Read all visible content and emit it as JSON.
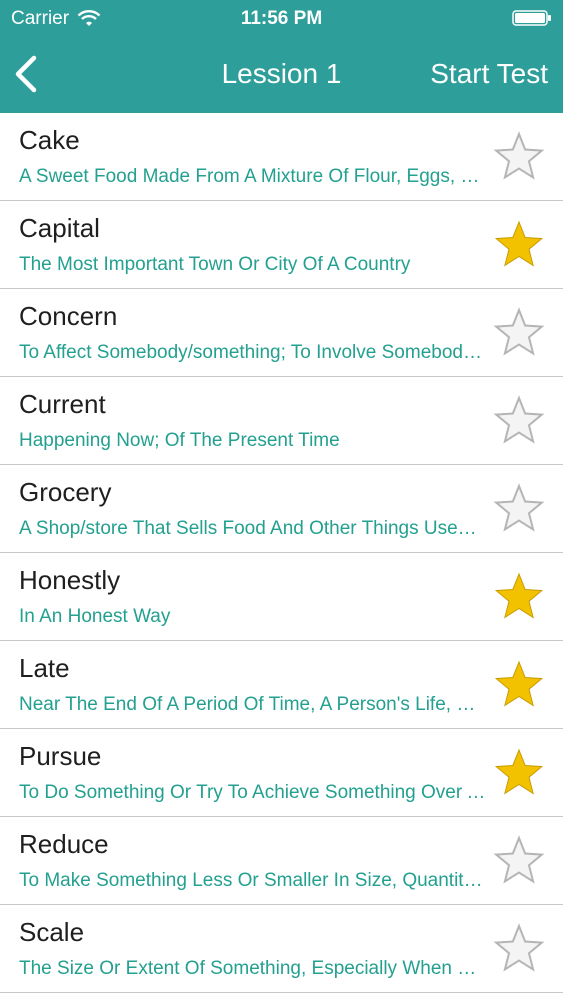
{
  "status": {
    "carrier": "Carrier",
    "time": "11:56 PM"
  },
  "nav": {
    "title": "Lession 1",
    "right_button": "Start Test",
    "back_icon": "chevron-left-icon"
  },
  "colors": {
    "header": "#2d9e9a",
    "definition_text": "#23a08f",
    "star_filled": "#f2c200"
  },
  "words": [
    {
      "word": "Cake",
      "definition": "A Sweet Food Made From A Mixture Of Flour, Eggs, Fat And Sugar",
      "starred": false
    },
    {
      "word": "Capital",
      "definition": "The Most Important Town Or City Of A Country",
      "starred": true
    },
    {
      "word": "Concern",
      "definition": "To Affect Somebody/something; To Involve Somebody/something",
      "starred": false
    },
    {
      "word": "Current",
      "definition": "Happening Now; Of The Present Time",
      "starred": false
    },
    {
      "word": "Grocery",
      "definition": "A Shop/store That Sells Food And Other Things Used In The Home",
      "starred": false
    },
    {
      "word": "Honestly",
      "definition": "In An Honest Way",
      "starred": true
    },
    {
      "word": "Late",
      "definition": "Near The End Of A Period Of Time, A Person's Life, Etc.",
      "starred": true
    },
    {
      "word": "Pursue",
      "definition": "To Do Something Or Try To Achieve Something Over A Period Of Time",
      "starred": true
    },
    {
      "word": "Reduce",
      "definition": "To Make Something Less Or Smaller In Size, Quantity, Price, Etc.",
      "starred": false
    },
    {
      "word": "Scale",
      "definition": "The Size Or Extent Of Something, Especially When Compared With Something Else",
      "starred": false
    }
  ]
}
